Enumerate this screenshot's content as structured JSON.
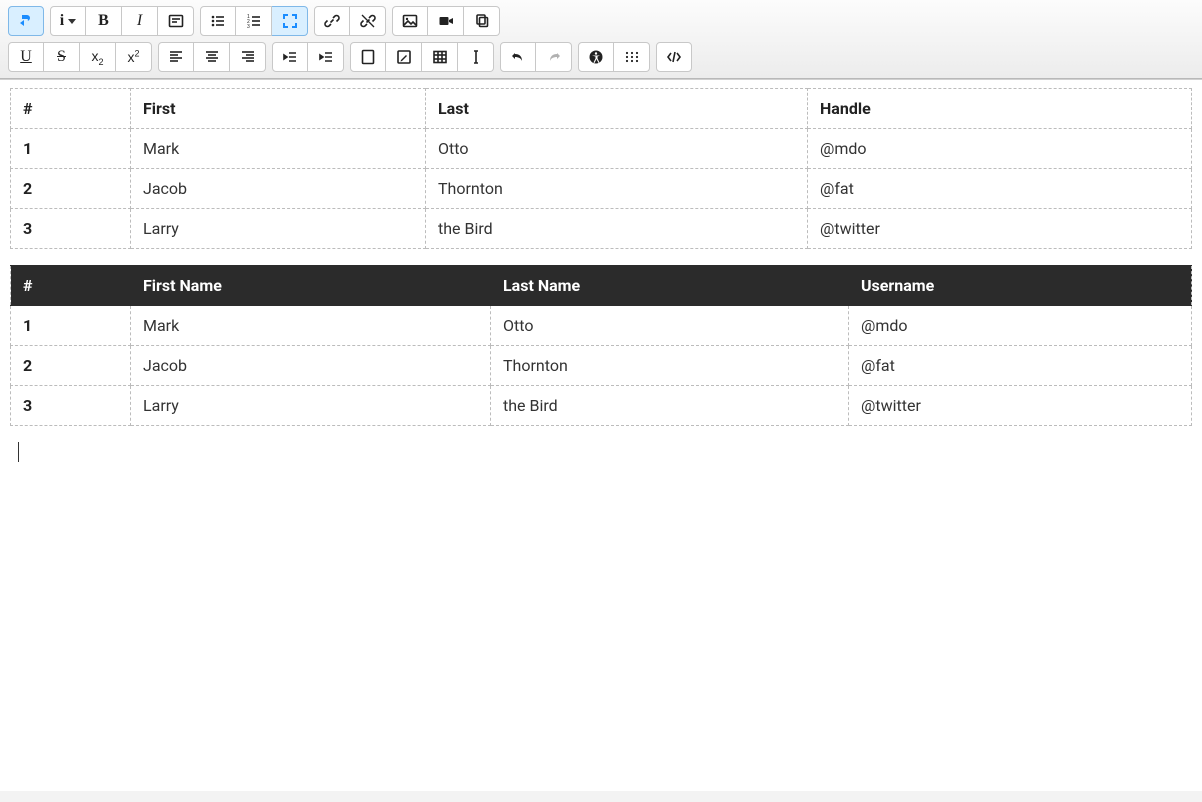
{
  "toolbar": {
    "row1": [
      {
        "group": "direction",
        "items": [
          {
            "name": "text-direction-button",
            "icon": "dir-arrow",
            "active": true
          }
        ]
      },
      {
        "group": "info",
        "items": [
          {
            "name": "info-button",
            "icon": "info",
            "caret": true
          },
          {
            "name": "bold-button",
            "icon": "bold"
          },
          {
            "name": "italic-button",
            "icon": "italic"
          },
          {
            "name": "tag-panel-button",
            "icon": "tag-panel"
          }
        ]
      },
      {
        "group": "lists",
        "items": [
          {
            "name": "unordered-list-button",
            "icon": "ul"
          },
          {
            "name": "ordered-list-button",
            "icon": "ol"
          },
          {
            "name": "fullscreen-button",
            "icon": "expand",
            "active": true
          }
        ]
      },
      {
        "group": "link",
        "items": [
          {
            "name": "link-button",
            "icon": "link"
          },
          {
            "name": "unlink-button",
            "icon": "unlink"
          }
        ]
      },
      {
        "group": "media",
        "items": [
          {
            "name": "image-button",
            "icon": "image"
          },
          {
            "name": "video-button",
            "icon": "video"
          },
          {
            "name": "copy-button",
            "icon": "copy"
          }
        ]
      }
    ],
    "row2": [
      {
        "group": "textstyle",
        "items": [
          {
            "name": "underline-button",
            "icon": "underline"
          },
          {
            "name": "strikethrough-button",
            "icon": "strike"
          },
          {
            "name": "subscript-button",
            "icon": "sub"
          },
          {
            "name": "superscript-button",
            "icon": "sup"
          }
        ]
      },
      {
        "group": "align",
        "items": [
          {
            "name": "align-left-button",
            "icon": "al-left"
          },
          {
            "name": "align-center-button",
            "icon": "al-center"
          },
          {
            "name": "align-right-button",
            "icon": "al-right"
          }
        ]
      },
      {
        "group": "indent",
        "items": [
          {
            "name": "outdent-button",
            "icon": "outdent"
          },
          {
            "name": "indent-button",
            "icon": "indent"
          }
        ]
      },
      {
        "group": "tables",
        "items": [
          {
            "name": "calculator-button",
            "icon": "calc"
          },
          {
            "name": "edit-button",
            "icon": "edit"
          },
          {
            "name": "insert-table-button",
            "icon": "table"
          },
          {
            "name": "text-cursor-button",
            "icon": "textcursor"
          }
        ]
      },
      {
        "group": "history",
        "items": [
          {
            "name": "undo-button",
            "icon": "undo"
          },
          {
            "name": "redo-button",
            "icon": "redo",
            "disabled": true
          }
        ]
      },
      {
        "group": "a11y",
        "items": [
          {
            "name": "accessibility-button",
            "icon": "a11y"
          },
          {
            "name": "braille-button",
            "icon": "braille"
          }
        ]
      },
      {
        "group": "source",
        "items": [
          {
            "name": "source-code-button",
            "icon": "code"
          }
        ]
      }
    ]
  },
  "table1": {
    "headers": [
      "#",
      "First",
      "Last",
      "Handle"
    ],
    "rows": [
      {
        "num": "1",
        "first": "Mark",
        "last": "Otto",
        "handle": "@mdo"
      },
      {
        "num": "2",
        "first": "Jacob",
        "last": "Thornton",
        "handle": "@fat"
      },
      {
        "num": "3",
        "first": "Larry",
        "last": "the Bird",
        "handle": "@twitter"
      }
    ]
  },
  "table2": {
    "headers": [
      "#",
      "First Name",
      "Last Name",
      "Username"
    ],
    "rows": [
      {
        "num": "1",
        "first": "Mark",
        "last": "Otto",
        "handle": "@mdo"
      },
      {
        "num": "2",
        "first": "Jacob",
        "last": "Thornton",
        "handle": "@fat"
      },
      {
        "num": "3",
        "first": "Larry",
        "last": "the Bird",
        "handle": "@twitter"
      }
    ]
  }
}
